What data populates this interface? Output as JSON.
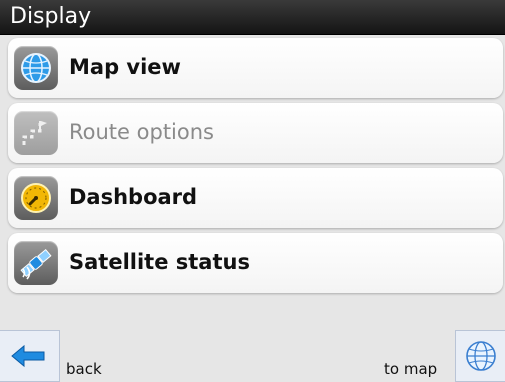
{
  "title": "Display",
  "menu": [
    {
      "label": "Map view",
      "icon": "globe-icon",
      "enabled": true
    },
    {
      "label": "Route options",
      "icon": "route-icon",
      "enabled": false
    },
    {
      "label": "Dashboard",
      "icon": "gauge-icon",
      "enabled": true
    },
    {
      "label": "Satellite status",
      "icon": "satellite-icon",
      "enabled": true
    }
  ],
  "bottom": {
    "back_label": "back",
    "map_label": "to map"
  },
  "colors": {
    "title_bg": "#141414",
    "accent_blue": "#1f8be0",
    "gauge_yellow": "#f2b705"
  }
}
